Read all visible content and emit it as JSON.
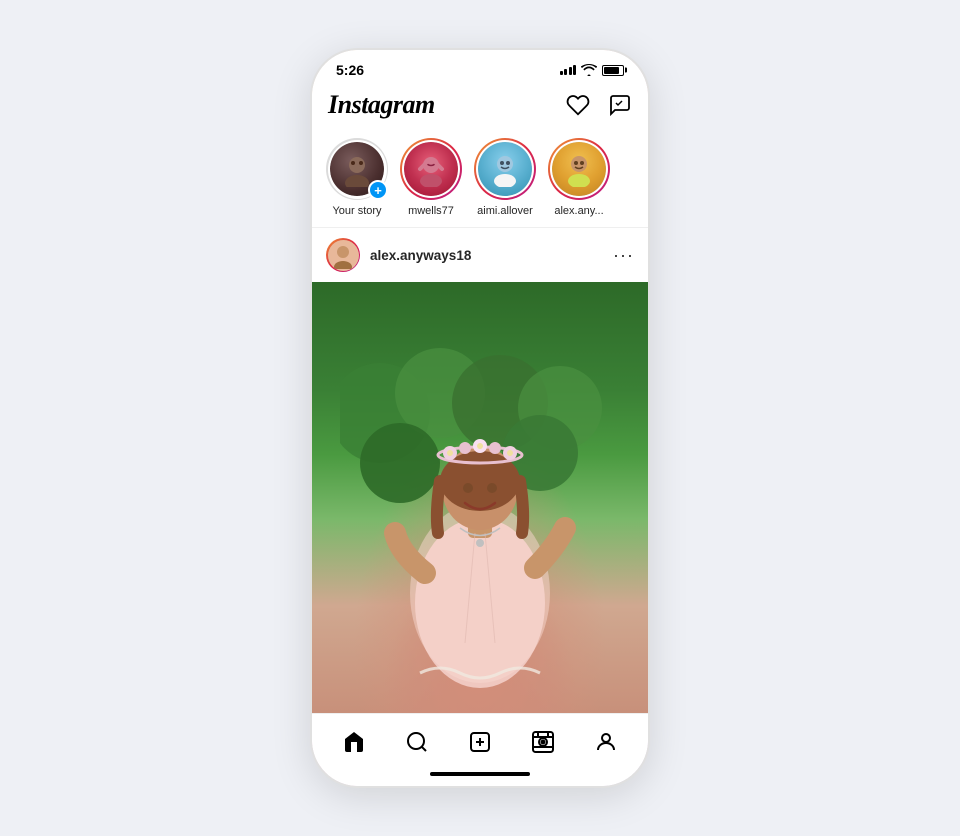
{
  "phone": {
    "status_bar": {
      "time": "5:26"
    },
    "header": {
      "logo": "Instagram",
      "heart_icon": "heart",
      "messenger_icon": "messenger"
    },
    "stories": [
      {
        "id": "your-story",
        "label": "Your story",
        "has_add": true,
        "ring": false,
        "avatar_type": "your-story-bg"
      },
      {
        "id": "mwells77",
        "label": "mwells77",
        "has_add": false,
        "ring": true,
        "avatar_type": "mwells-bg"
      },
      {
        "id": "aimi-allover",
        "label": "aimi.allover",
        "has_add": false,
        "ring": true,
        "avatar_type": "aimi-bg"
      },
      {
        "id": "alex-any",
        "label": "alex.any...",
        "has_add": false,
        "ring": true,
        "avatar_type": "alex-bg"
      }
    ],
    "post": {
      "username": "alex.anyways18",
      "more_icon": "ellipsis"
    },
    "bottom_nav": {
      "items": [
        {
          "id": "home",
          "icon": "home",
          "active": true
        },
        {
          "id": "search",
          "icon": "search",
          "active": false
        },
        {
          "id": "add",
          "icon": "plus-square",
          "active": false
        },
        {
          "id": "reels",
          "icon": "reels",
          "active": false
        },
        {
          "id": "profile",
          "icon": "person",
          "active": false
        }
      ]
    }
  }
}
